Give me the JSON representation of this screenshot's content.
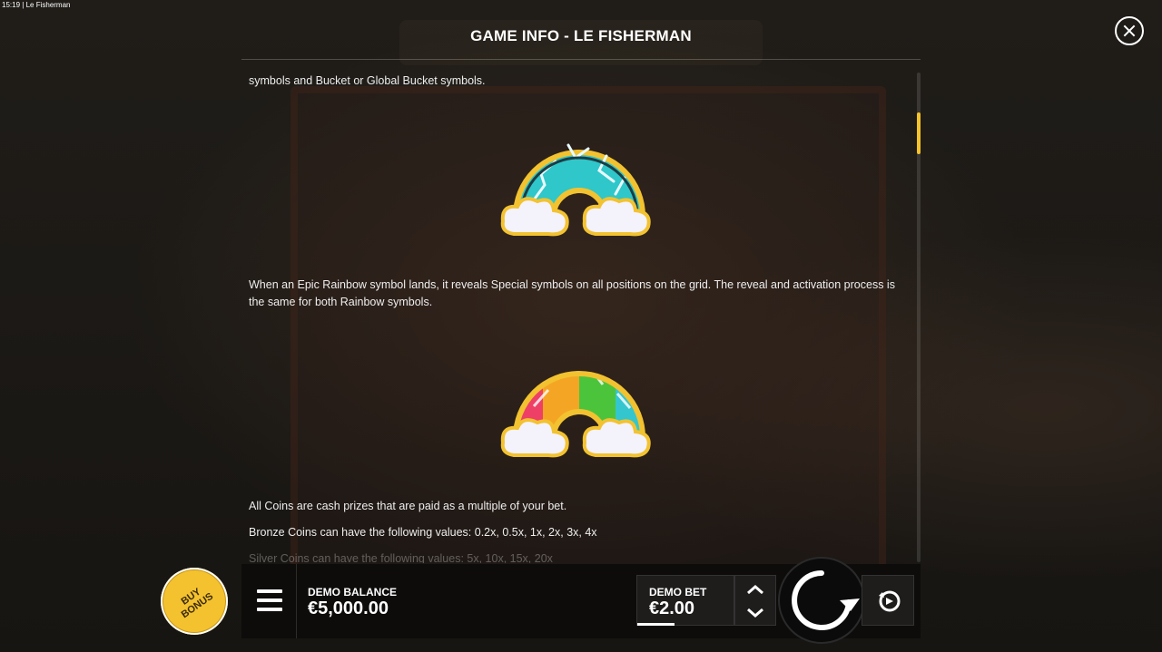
{
  "window": {
    "time": "15:19",
    "app_title": "Le Fisherman"
  },
  "info": {
    "title": "GAME INFO - LE FISHERMAN",
    "paragraphs": [
      "symbols and Bucket or Global Bucket symbols.",
      "When an Epic Rainbow symbol lands, it reveals Special symbols on all positions on the grid. The reveal and activation process is the same for both Rainbow symbols.",
      "All Coins are cash prizes that are paid as a multiple of your bet.",
      "Bronze Coins can have the following values: 0.2x, 0.5x, 1x, 2x, 3x, 4x",
      "Silver Coins can have the following values: 5x, 10x, 15x, 20x"
    ],
    "symbols": [
      "rainbow-symbol-icon",
      "epic-rainbow-symbol-icon"
    ]
  },
  "controls": {
    "buy_bonus": "BUY BONUS",
    "balance_label": "DEMO BALANCE",
    "balance_value": "€5,000.00",
    "bet_label": "DEMO BET",
    "bet_value": "€2.00"
  },
  "colors": {
    "accent": "#f5c32b",
    "panel": "#0d0c0b",
    "text": "#ffffff"
  }
}
